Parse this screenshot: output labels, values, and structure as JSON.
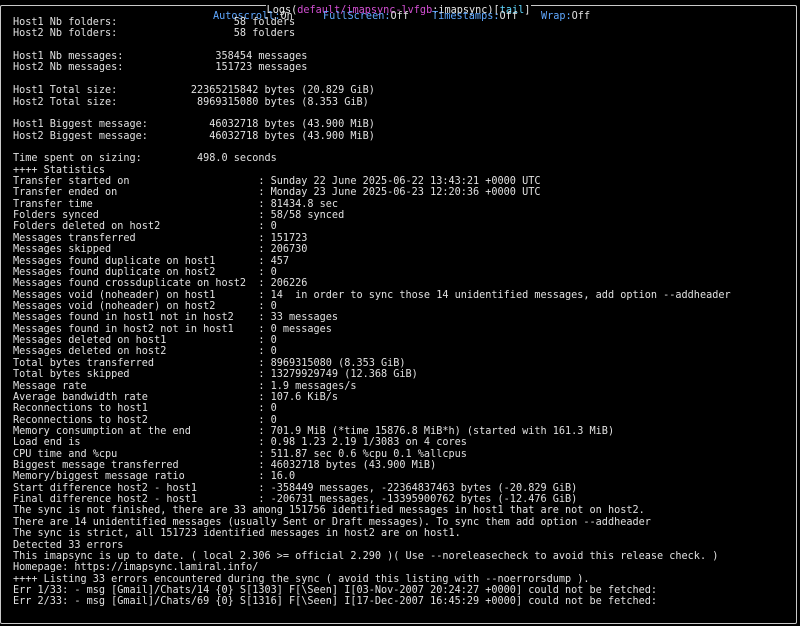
{
  "window": {
    "title_prefix": "Logs(",
    "title_path": "default/imapsync-lvfgb",
    "title_sep": ":",
    "title_container": "imapsync",
    "title_suffix": ")[",
    "title_mode": "tail",
    "title_end": "]"
  },
  "statusbar": {
    "autoscroll": {
      "key": "Autoscroll:",
      "value": "On"
    },
    "fullscreen": {
      "key": "FullScreen:",
      "value": "Off"
    },
    "timestamps": {
      "key": "Timestamps:",
      "value": "Off"
    },
    "wrap": {
      "key": "Wrap:",
      "value": "Off"
    }
  },
  "colors": {
    "background": "#000000",
    "text": "#e0e0e0",
    "accent_blue": "#5fa8ff",
    "accent_magenta": "#d24fd2",
    "accent_cyan": "#5fd7ff",
    "frame": "#c9c9c9"
  },
  "log_lines": [
    "Host1 Nb folders:                   58 folders",
    "Host2 Nb folders:                   58 folders",
    "",
    "Host1 Nb messages:               358454 messages",
    "Host2 Nb messages:               151723 messages",
    "",
    "Host1 Total size:            22365215842 bytes (20.829 GiB)",
    "Host2 Total size:             8969315080 bytes (8.353 GiB)",
    "",
    "Host1 Biggest message:          46032718 bytes (43.900 MiB)",
    "Host2 Biggest message:          46032718 bytes (43.900 MiB)",
    "",
    "Time spent on sizing:         498.0 seconds",
    "++++ Statistics",
    "Transfer started on                     : Sunday 22 June 2025-06-22 13:43:21 +0000 UTC",
    "Transfer ended on                       : Monday 23 June 2025-06-23 12:20:36 +0000 UTC",
    "Transfer time                           : 81434.8 sec",
    "Folders synced                          : 58/58 synced",
    "Folders deleted on host2                : 0",
    "Messages transferred                    : 151723",
    "Messages skipped                        : 206730",
    "Messages found duplicate on host1       : 457",
    "Messages found duplicate on host2       : 0",
    "Messages found crossduplicate on host2  : 206226",
    "Messages void (noheader) on host1       : 14  in order to sync those 14 unidentified messages, add option --addheader",
    "Messages void (noheader) on host2       : 0",
    "Messages found in host1 not in host2    : 33 messages",
    "Messages found in host2 not in host1    : 0 messages",
    "Messages deleted on host1               : 0",
    "Messages deleted on host2               : 0",
    "Total bytes transferred                 : 8969315080 (8.353 GiB)",
    "Total bytes skipped                     : 13279929749 (12.368 GiB)",
    "Message rate                            : 1.9 messages/s",
    "Average bandwidth rate                  : 107.6 KiB/s",
    "Reconnections to host1                  : 0",
    "Reconnections to host2                  : 0",
    "Memory consumption at the end           : 701.9 MiB (*time 15876.8 MiB*h) (started with 161.3 MiB)",
    "Load end is                             : 0.98 1.23 2.19 1/3083 on 4 cores",
    "CPU time and %cpu                       : 511.87 sec 0.6 %cpu 0.1 %allcpus",
    "Biggest message transferred             : 46032718 bytes (43.900 MiB)",
    "Memory/biggest message ratio            : 16.0",
    "Start difference host2 - host1          : -358449 messages, -22364837463 bytes (-20.829 GiB)",
    "Final difference host2 - host1          : -206731 messages, -13395900762 bytes (-12.476 GiB)",
    "The sync is not finished, there are 33 among 151756 identified messages in host1 that are not on host2.",
    "There are 14 unidentified messages (usually Sent or Draft messages). To sync them add option --addheader",
    "The sync is strict, all 151723 identified messages in host2 are on host1.",
    "Detected 33 errors",
    "This imapsync is up to date. ( local 2.306 >= official 2.290 )( Use --noreleasecheck to avoid this release check. )",
    "Homepage: https://imapsync.lamiral.info/",
    "++++ Listing 33 errors encountered during the sync ( avoid this listing with --noerrorsdump ).",
    "Err 1/33: - msg [Gmail]/Chats/14 {0} S[1303] F[\\Seen] I[03-Nov-2007 20:24:27 +0000] could not be fetched:",
    "Err 2/33: - msg [Gmail]/Chats/69 {0} S[1316] F[\\Seen] I[17-Dec-2007 16:45:29 +0000] could not be fetched:"
  ]
}
